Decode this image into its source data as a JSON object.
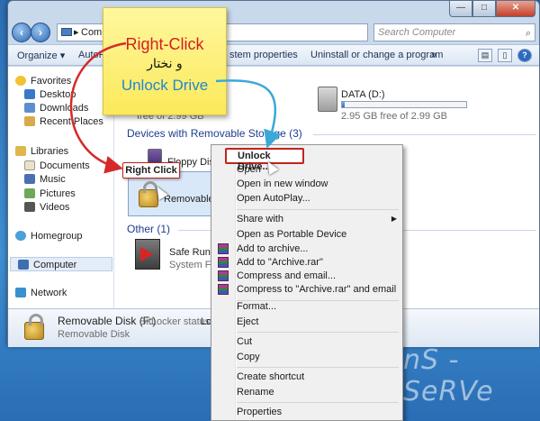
{
  "desktop": {
    "watermark": "nS - SeRVe"
  },
  "window": {
    "buttons": {
      "minimize": "—",
      "maximize": "□",
      "close": "✕"
    },
    "address": {
      "path": "Comp",
      "separator": "▸"
    },
    "search": {
      "placeholder": "Search Computer"
    },
    "toolbar": {
      "organize": "Organize ▾",
      "autoplay": "AutoP",
      "system_properties": "stem properties",
      "uninstall": "Uninstall or change a program",
      "more": "»"
    }
  },
  "nav": {
    "favorites": "Favorites",
    "desktop": "Desktop",
    "downloads": "Downloads",
    "recent": "Recent Places",
    "libraries": "Libraries",
    "documents": "Documents",
    "music": "Music",
    "pictures": "Pictures",
    "videos": "Videos",
    "homegroup": "Homegroup",
    "computer": "Computer",
    "network": "Network"
  },
  "main": {
    "top_drive_sub": "free of 2.99 GB",
    "data_drive": {
      "name": "DATA (D:)",
      "free": "2.95 GB free of 2.99 GB",
      "fill": 0.02
    },
    "removable_header": "Devices with Removable Storage (3)",
    "floppy": "Floppy Disk Dr",
    "removable_disk": "Removable Disk",
    "other_header": "Other (1)",
    "safe_run": "Safe Run Share",
    "system_folder": "System Folder"
  },
  "details": {
    "name": "Removable Disk (F:)",
    "bitlocker_label": "BitLocker status:",
    "bitlocker_value": "Loc",
    "type": "Removable Disk"
  },
  "context_menu": {
    "unlock": "Unlock Drive...",
    "open": "Open",
    "open_new_window": "Open in new window",
    "open_autoplay": "Open AutoPlay...",
    "share_with": "Share with",
    "open_portable": "Open as Portable Device",
    "add_archive": "Add to archive...",
    "add_archive_rar": "Add to \"Archive.rar\"",
    "compress_email": "Compress and email...",
    "compress_rar_email": "Compress to \"Archive.rar\" and email",
    "format": "Format...",
    "eject": "Eject",
    "cut": "Cut",
    "copy": "Copy",
    "create_shortcut": "Create shortcut",
    "rename": "Rename",
    "properties": "Properties"
  },
  "annotation": {
    "line1": "Right-Click",
    "line2": "و نختار",
    "line3": "Unlock Drive",
    "callout": "Right Click"
  }
}
